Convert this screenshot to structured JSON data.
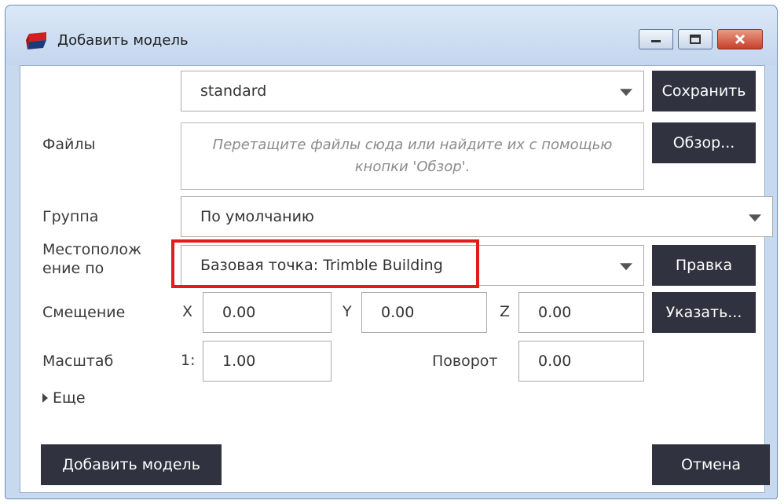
{
  "window": {
    "title": "Добавить модель",
    "colors": {
      "button_dark": "#31323f",
      "highlight": "#e21b1b",
      "accent_icon": "#d21e1e"
    }
  },
  "template": {
    "value": "standard",
    "save_label": "Сохранить"
  },
  "files": {
    "label": "Файлы",
    "drop_hint": "Перетащите файлы сюда или найдите их с помощью кнопки 'Обзор'.",
    "browse_label": "Обзор..."
  },
  "group": {
    "label": "Группа",
    "value": "По умолчанию"
  },
  "placement": {
    "label": "Местополож ение по",
    "value": "Базовая точка: Trimble Building",
    "edit_label": "Правка"
  },
  "offset": {
    "label": "Смещение",
    "x_label": "X",
    "x_value": "0.00",
    "y_label": "Y",
    "y_value": "0.00",
    "z_label": "Z",
    "z_value": "0.00",
    "pick_label": "Указать..."
  },
  "scale": {
    "label": "Масштаб",
    "prefix": "1:",
    "value": "1.00"
  },
  "rotation": {
    "label": "Поворот",
    "value": "0.00"
  },
  "more": {
    "label": "Еще"
  },
  "footer": {
    "add_label": "Добавить модель",
    "cancel_label": "Отмена"
  }
}
